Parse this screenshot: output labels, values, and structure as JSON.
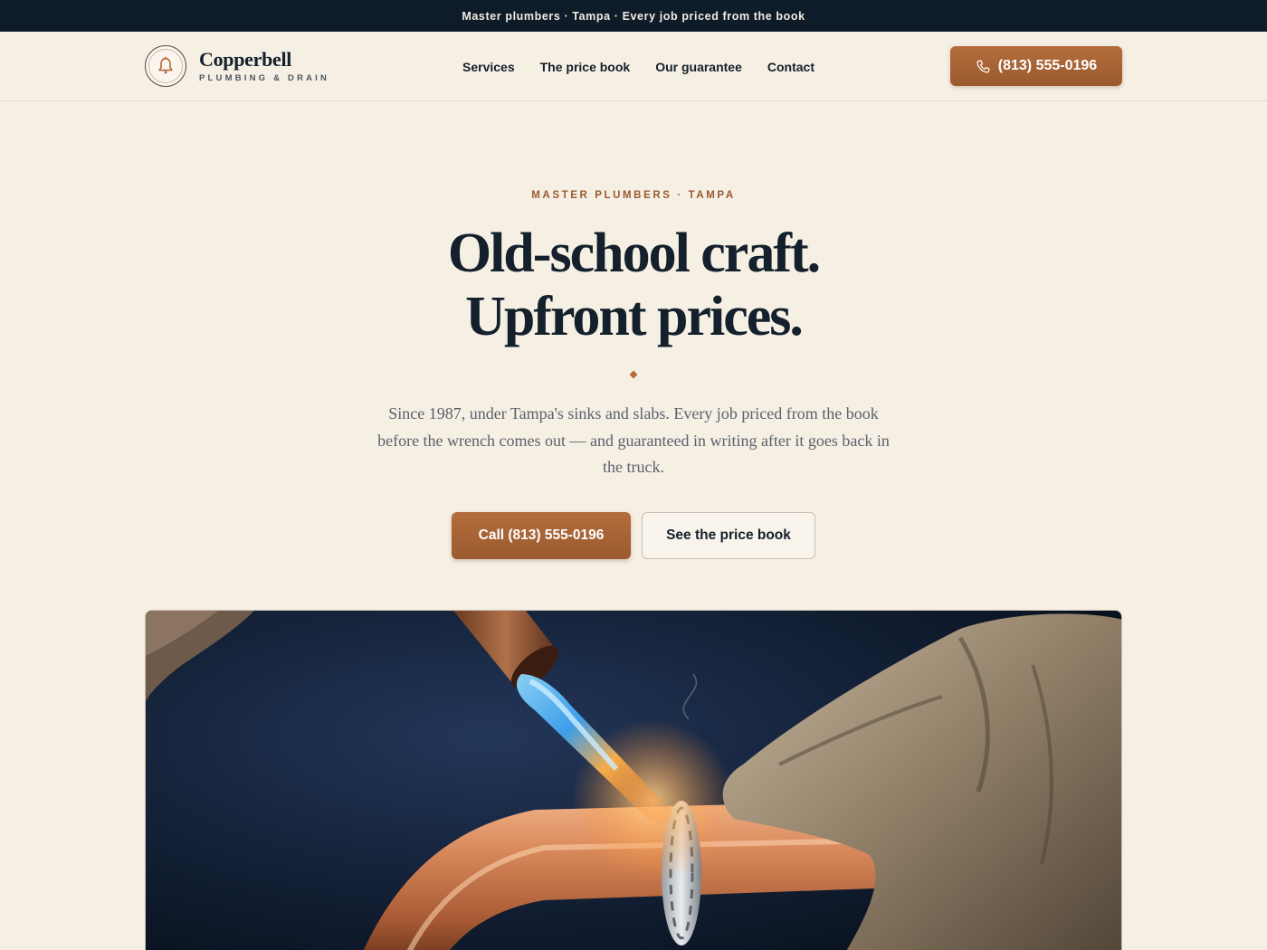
{
  "announcement": "Master plumbers · Tampa · Every job priced from the book",
  "brand": {
    "name": "Copperbell",
    "tagline": "PLUMBING & DRAIN",
    "logo_icon": "bell-icon"
  },
  "nav": {
    "items": [
      {
        "label": "Services"
      },
      {
        "label": "The price book"
      },
      {
        "label": "Our guarantee"
      },
      {
        "label": "Contact"
      }
    ],
    "phone_button": {
      "label": "(813) 555-0196",
      "icon": "phone-icon"
    }
  },
  "hero": {
    "eyebrow": "MASTER PLUMBERS · TAMPA",
    "title_line1": "Old-school craft.",
    "title_line2": "Upfront prices.",
    "lede": "Since 1987, under Tampa's sinks and slabs. Every job priced from the book before the wrench comes out — and guaranteed in writing after it goes back in the truck.",
    "cta_primary": "Call (813) 555-0196",
    "cta_secondary": "See the price book"
  },
  "photo": {
    "subject": "torch-soldering-copper-pipe-image"
  },
  "colors": {
    "background": "#f5efe4",
    "navy": "#0e1b28",
    "copper": "#a8632f",
    "text": "#14202b"
  }
}
